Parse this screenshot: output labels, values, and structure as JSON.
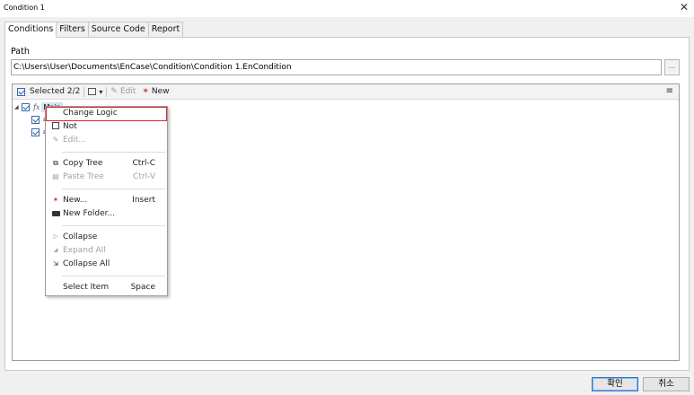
{
  "window": {
    "title": "Condition 1",
    "close_glyph": "✕"
  },
  "tabs": [
    "Conditions",
    "Filters",
    "Source Code",
    "Report"
  ],
  "path": {
    "label": "Path",
    "value": "C:\\Users\\User\\Documents\\EnCase\\Condition\\Condition 1.EnCondition",
    "browse_label": "..."
  },
  "toolbar": {
    "selected": "Selected 2/2",
    "dropdown_glyph": "▾",
    "edit": "Edit",
    "new": "New",
    "menu_glyph": "≡"
  },
  "tree": {
    "main_label": "Main",
    "child_1_label": "a",
    "child_2_label": "a"
  },
  "context_menu": {
    "change_logic": "Change Logic",
    "not": "Not",
    "edit": "Edit...",
    "copy_tree": "Copy Tree",
    "copy_tree_key": "Ctrl-C",
    "paste_tree": "Paste Tree",
    "paste_tree_key": "Ctrl-V",
    "new": "New...",
    "new_key": "Insert",
    "new_folder": "New Folder...",
    "collapse": "Collapse",
    "expand_all": "Expand All",
    "collapse_all": "Collapse All",
    "select_item": "Select Item",
    "select_item_key": "Space"
  },
  "buttons": {
    "ok": "확인",
    "cancel": "취소"
  },
  "colors": {
    "highlight_outline": "#e0262b",
    "selection_bg": "#cde4f7",
    "accent_blue": "#2e74cf"
  }
}
